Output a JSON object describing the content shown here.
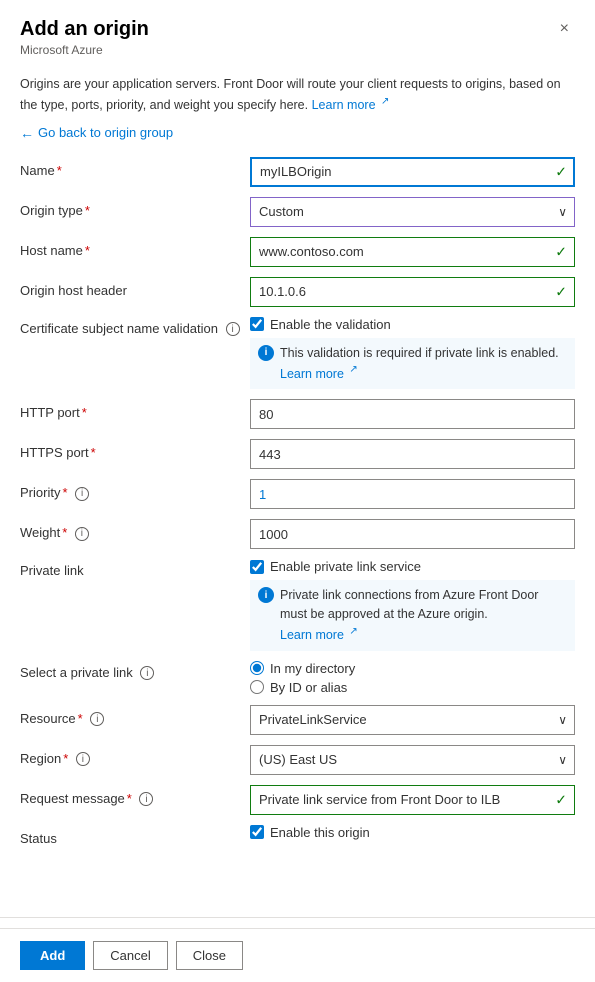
{
  "panel": {
    "title": "Add an origin",
    "subtitle": "Microsoft Azure",
    "close_label": "×"
  },
  "description": {
    "text": "Origins are your application servers. Front Door will route your client requests to origins, based on the type, ports, priority, and weight you specify here.",
    "learn_more": "Learn more",
    "learn_more_url": "#"
  },
  "back_link": "Go back to origin group",
  "form": {
    "name": {
      "label": "Name",
      "required": true,
      "value": "myILBOrigin",
      "has_check": true
    },
    "origin_type": {
      "label": "Origin type",
      "required": true,
      "value": "Custom",
      "has_dropdown": true
    },
    "host_name": {
      "label": "Host name",
      "required": true,
      "value": "www.contoso.com",
      "has_check": true
    },
    "origin_host_header": {
      "label": "Origin host header",
      "value": "10.1.0.6",
      "has_check": true
    },
    "cert_validation": {
      "label": "Certificate subject name validation",
      "has_info": true,
      "checkbox_label": "Enable the validation",
      "checked": true,
      "info_text": "This validation is required if private link is enabled.",
      "info_learn_more": "Learn more"
    },
    "http_port": {
      "label": "HTTP port",
      "required": true,
      "value": "80"
    },
    "https_port": {
      "label": "HTTPS port",
      "required": true,
      "value": "443"
    },
    "priority": {
      "label": "Priority",
      "required": true,
      "has_info": true,
      "value": "1"
    },
    "weight": {
      "label": "Weight",
      "required": true,
      "has_info": true,
      "value": "1000"
    },
    "private_link": {
      "label": "Private link",
      "checkbox_label": "Enable private link service",
      "checked": true,
      "info_text": "Private link connections from Azure Front Door must be approved at the Azure origin.",
      "info_learn_more": "Learn more"
    },
    "select_private_link": {
      "label": "Select a private link",
      "has_info": true,
      "options": [
        {
          "label": "In my directory",
          "value": "in_my_directory",
          "selected": true
        },
        {
          "label": "By ID or alias",
          "value": "by_id_or_alias",
          "selected": false
        }
      ]
    },
    "resource": {
      "label": "Resource",
      "required": true,
      "has_info": true,
      "value": "PrivateLinkService"
    },
    "region": {
      "label": "Region",
      "required": true,
      "has_info": true,
      "value": "(US) East US"
    },
    "request_message": {
      "label": "Request message",
      "required": true,
      "has_info": true,
      "value": "Private link service from Front Door to ILB",
      "has_check": true
    },
    "status": {
      "label": "Status",
      "checkbox_label": "Enable this origin",
      "checked": true
    }
  },
  "footer": {
    "add_label": "Add",
    "cancel_label": "Cancel",
    "close_label": "Close"
  }
}
